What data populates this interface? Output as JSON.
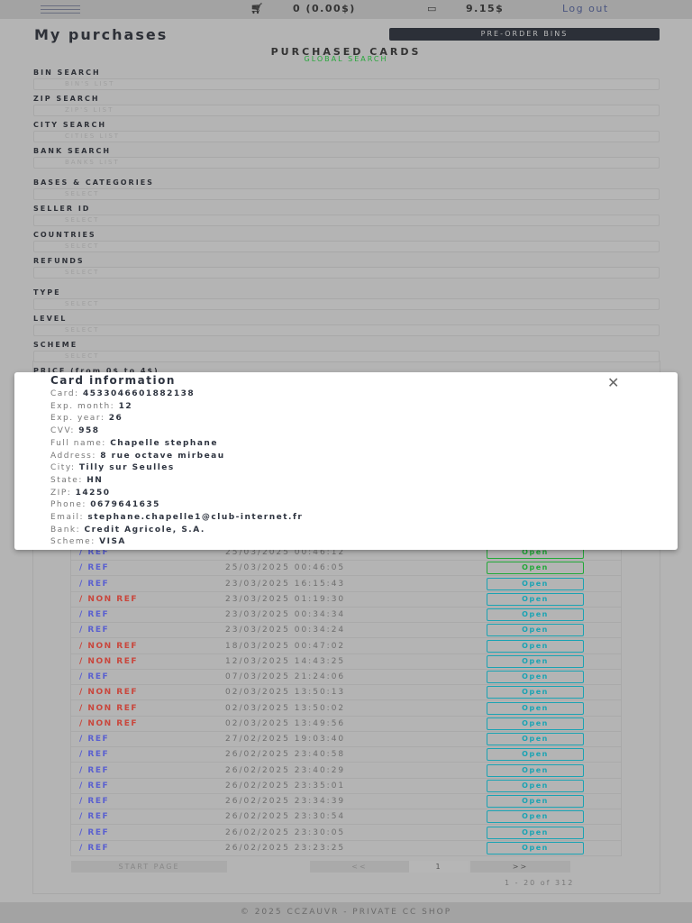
{
  "header": {
    "cart": "0 (0.00$)",
    "balance": "9.15$",
    "logout": "Log out"
  },
  "page": {
    "title": "My purchases",
    "preorder": "PRE-ORDER BINS",
    "subtitle": "PURCHASED CARDS",
    "global_search": "GLOBAL SEARCH"
  },
  "filters": [
    {
      "label": "BIN SEARCH",
      "placeholder": "BIN'S LIST"
    },
    {
      "label": "ZIP SEARCH",
      "placeholder": "ZIP'S LIST"
    },
    {
      "label": "CITY SEARCH",
      "placeholder": "CITIES LIST"
    },
    {
      "label": "BANK SEARCH",
      "placeholder": "BANKS LIST"
    },
    {
      "label": "BASES & CATEGORIES",
      "placeholder": "SELECT"
    },
    {
      "label": "SELLER ID",
      "placeholder": "SELECT"
    },
    {
      "label": "COUNTRIES",
      "placeholder": "SELECT"
    },
    {
      "label": "REFUNDS",
      "placeholder": "SELECT"
    },
    {
      "label": "TYPE",
      "placeholder": "SELECT"
    },
    {
      "label": "LEVEL",
      "placeholder": "SELECT"
    },
    {
      "label": "SCHEME",
      "placeholder": "SELECT"
    },
    {
      "label": "PRICE (from 0$ to 4$)",
      "placeholder": ""
    }
  ],
  "modal": {
    "title": "Card information",
    "fields": [
      {
        "k": "Card:",
        "v": "4533046601882138"
      },
      {
        "k": "Exp. month:",
        "v": "12"
      },
      {
        "k": "Exp. year:",
        "v": "26"
      },
      {
        "k": "CVV:",
        "v": "958"
      },
      {
        "k": "Full name:",
        "v": "Chapelle stephane"
      },
      {
        "k": "Address:",
        "v": "8 rue octave mirbeau"
      },
      {
        "k": "City:",
        "v": "Tilly sur Seulles"
      },
      {
        "k": "State:",
        "v": "HN"
      },
      {
        "k": "ZIP:",
        "v": "14250"
      },
      {
        "k": "Phone:",
        "v": "0679641635"
      },
      {
        "k": "Email:",
        "v": "stephane.chapelle1@club-internet.fr"
      },
      {
        "k": "Bank:",
        "v": "Credit Agricole, S.A."
      },
      {
        "k": "Scheme:",
        "v": "VISA"
      }
    ]
  },
  "colors": {
    "ref": "#5a60d0",
    "nonref": "#c9463c",
    "open_green": "#22a838",
    "open_teal": "#1aa3b3"
  },
  "rows": [
    {
      "type": "/ REF",
      "date": "25/03/2025 00:46:12",
      "action": "Open",
      "opened": true
    },
    {
      "type": "/ REF",
      "date": "25/03/2025 00:46:05",
      "action": "Open",
      "opened": true
    },
    {
      "type": "/ REF",
      "date": "23/03/2025 16:15:43",
      "action": "Open"
    },
    {
      "type": "/ NON REF",
      "date": "23/03/2025 01:19:30",
      "action": "Open"
    },
    {
      "type": "/ REF",
      "date": "23/03/2025 00:34:34",
      "action": "Open"
    },
    {
      "type": "/ REF",
      "date": "23/03/2025 00:34:24",
      "action": "Open"
    },
    {
      "type": "/ NON REF",
      "date": "18/03/2025 00:47:02",
      "action": "Open"
    },
    {
      "type": "/ NON REF",
      "date": "12/03/2025 14:43:25",
      "action": "Open"
    },
    {
      "type": "/ REF",
      "date": "07/03/2025 21:24:06",
      "action": "Open"
    },
    {
      "type": "/ NON REF",
      "date": "02/03/2025 13:50:13",
      "action": "Open"
    },
    {
      "type": "/ NON REF",
      "date": "02/03/2025 13:50:02",
      "action": "Open"
    },
    {
      "type": "/ NON REF",
      "date": "02/03/2025 13:49:56",
      "action": "Open"
    },
    {
      "type": "/ REF",
      "date": "27/02/2025 19:03:40",
      "action": "Open"
    },
    {
      "type": "/ REF",
      "date": "26/02/2025 23:40:58",
      "action": "Open"
    },
    {
      "type": "/ REF",
      "date": "26/02/2025 23:40:29",
      "action": "Open"
    },
    {
      "type": "/ REF",
      "date": "26/02/2025 23:35:01",
      "action": "Open"
    },
    {
      "type": "/ REF",
      "date": "26/02/2025 23:34:39",
      "action": "Open"
    },
    {
      "type": "/ REF",
      "date": "26/02/2025 23:30:54",
      "action": "Open"
    },
    {
      "type": "/ REF",
      "date": "26/02/2025 23:30:05",
      "action": "Open"
    },
    {
      "type": "/ REF",
      "date": "26/02/2025 23:23:25",
      "action": "Open"
    }
  ],
  "pagination": {
    "start": "START PAGE",
    "prev": "<<",
    "current": "1",
    "next": ">>",
    "count": "1 - 20 of 312"
  },
  "footer": "© 2025 CCZAUVR - PRIVATE CC SHOP"
}
